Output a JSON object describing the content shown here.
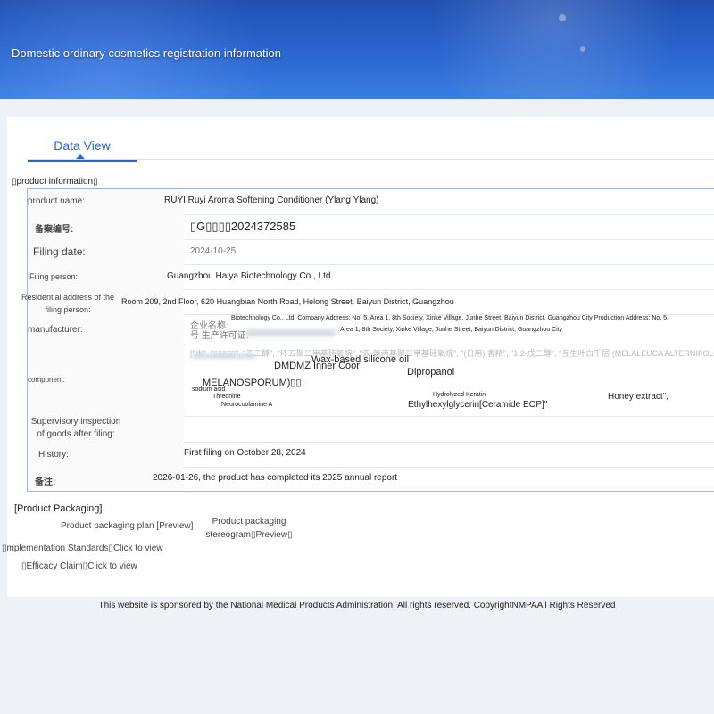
{
  "banner": {
    "title": "Domestic ordinary cosmetics registration information"
  },
  "tab": {
    "label": "Data View"
  },
  "section": {
    "title": "▯product information▯"
  },
  "fields": {
    "product_name": {
      "label": "product name:",
      "value": "RUYI Ruyi Aroma Softening Conditioner (Ylang Ylang)"
    },
    "record_no": {
      "label": "备案编号:",
      "value": "▯G▯▯▯▯2024372585"
    },
    "filing_date": {
      "label": "Filing date:",
      "value": "2024-10-25"
    },
    "filing_person": {
      "label": "Filing person:",
      "value": "Guangzhou Haiya Biotechnology Co., Ltd."
    },
    "address": {
      "label": "Residential address of the filing person:",
      "value": "Room 209, 2nd Floor, 620 Huangbian North Road, Helong Street, Baiyun District, Guangzhou"
    },
    "manufacturer": {
      "label": "manufacturer:",
      "prefix": "企业名称:",
      "prefix2": "号 生产许可证:",
      "line1": "Biotechnology Co., Ltd. Company Address: No. 5, Area 1, 8th Society, Xinke Village, Junhe Street, Baiyun District, Guangzhou City Production Address: No. 5,",
      "line2": "Area 1, 8th Society, Xinke Village, Junhe Street, Baiyun District, Guangzhou City"
    },
    "component": {
      "label": "component:",
      "overlays": [
        "Wax-based silicone oil",
        "DMDMZ Inner Coor",
        "Dipropanol",
        "MELANOSPORUM)▯▯",
        "sodium acid",
        "Threonine",
        "Hydrolyzed Keratin",
        "Honey extract\",",
        "Neurocoolamine A",
        "Ethylhexylglycerin[Ceramide EOP]\""
      ]
    },
    "inspection": {
      "label": "Supervisory inspection of goods after filing:",
      "value": ""
    },
    "history": {
      "label": "History:",
      "value": "First filing on October 28, 2024"
    },
    "remark": {
      "label": "备注:",
      "value": "2026-01-26, the product has completed its 2025 annual report"
    }
  },
  "packaging": {
    "title": "[Product Packaging]",
    "plan": "Product packaging plan [Preview]",
    "stereogram": "Product packaging stereogram▯Preview▯",
    "standards": "▯mplementation Standards▯Click to view",
    "efficacy": "▯Efficacy Claim▯Click to view"
  },
  "footer": {
    "text": "This website is sponsored by the National Medical Products Administration. All rights reserved. CopyrightNMPAAll Rights Reserved"
  }
}
